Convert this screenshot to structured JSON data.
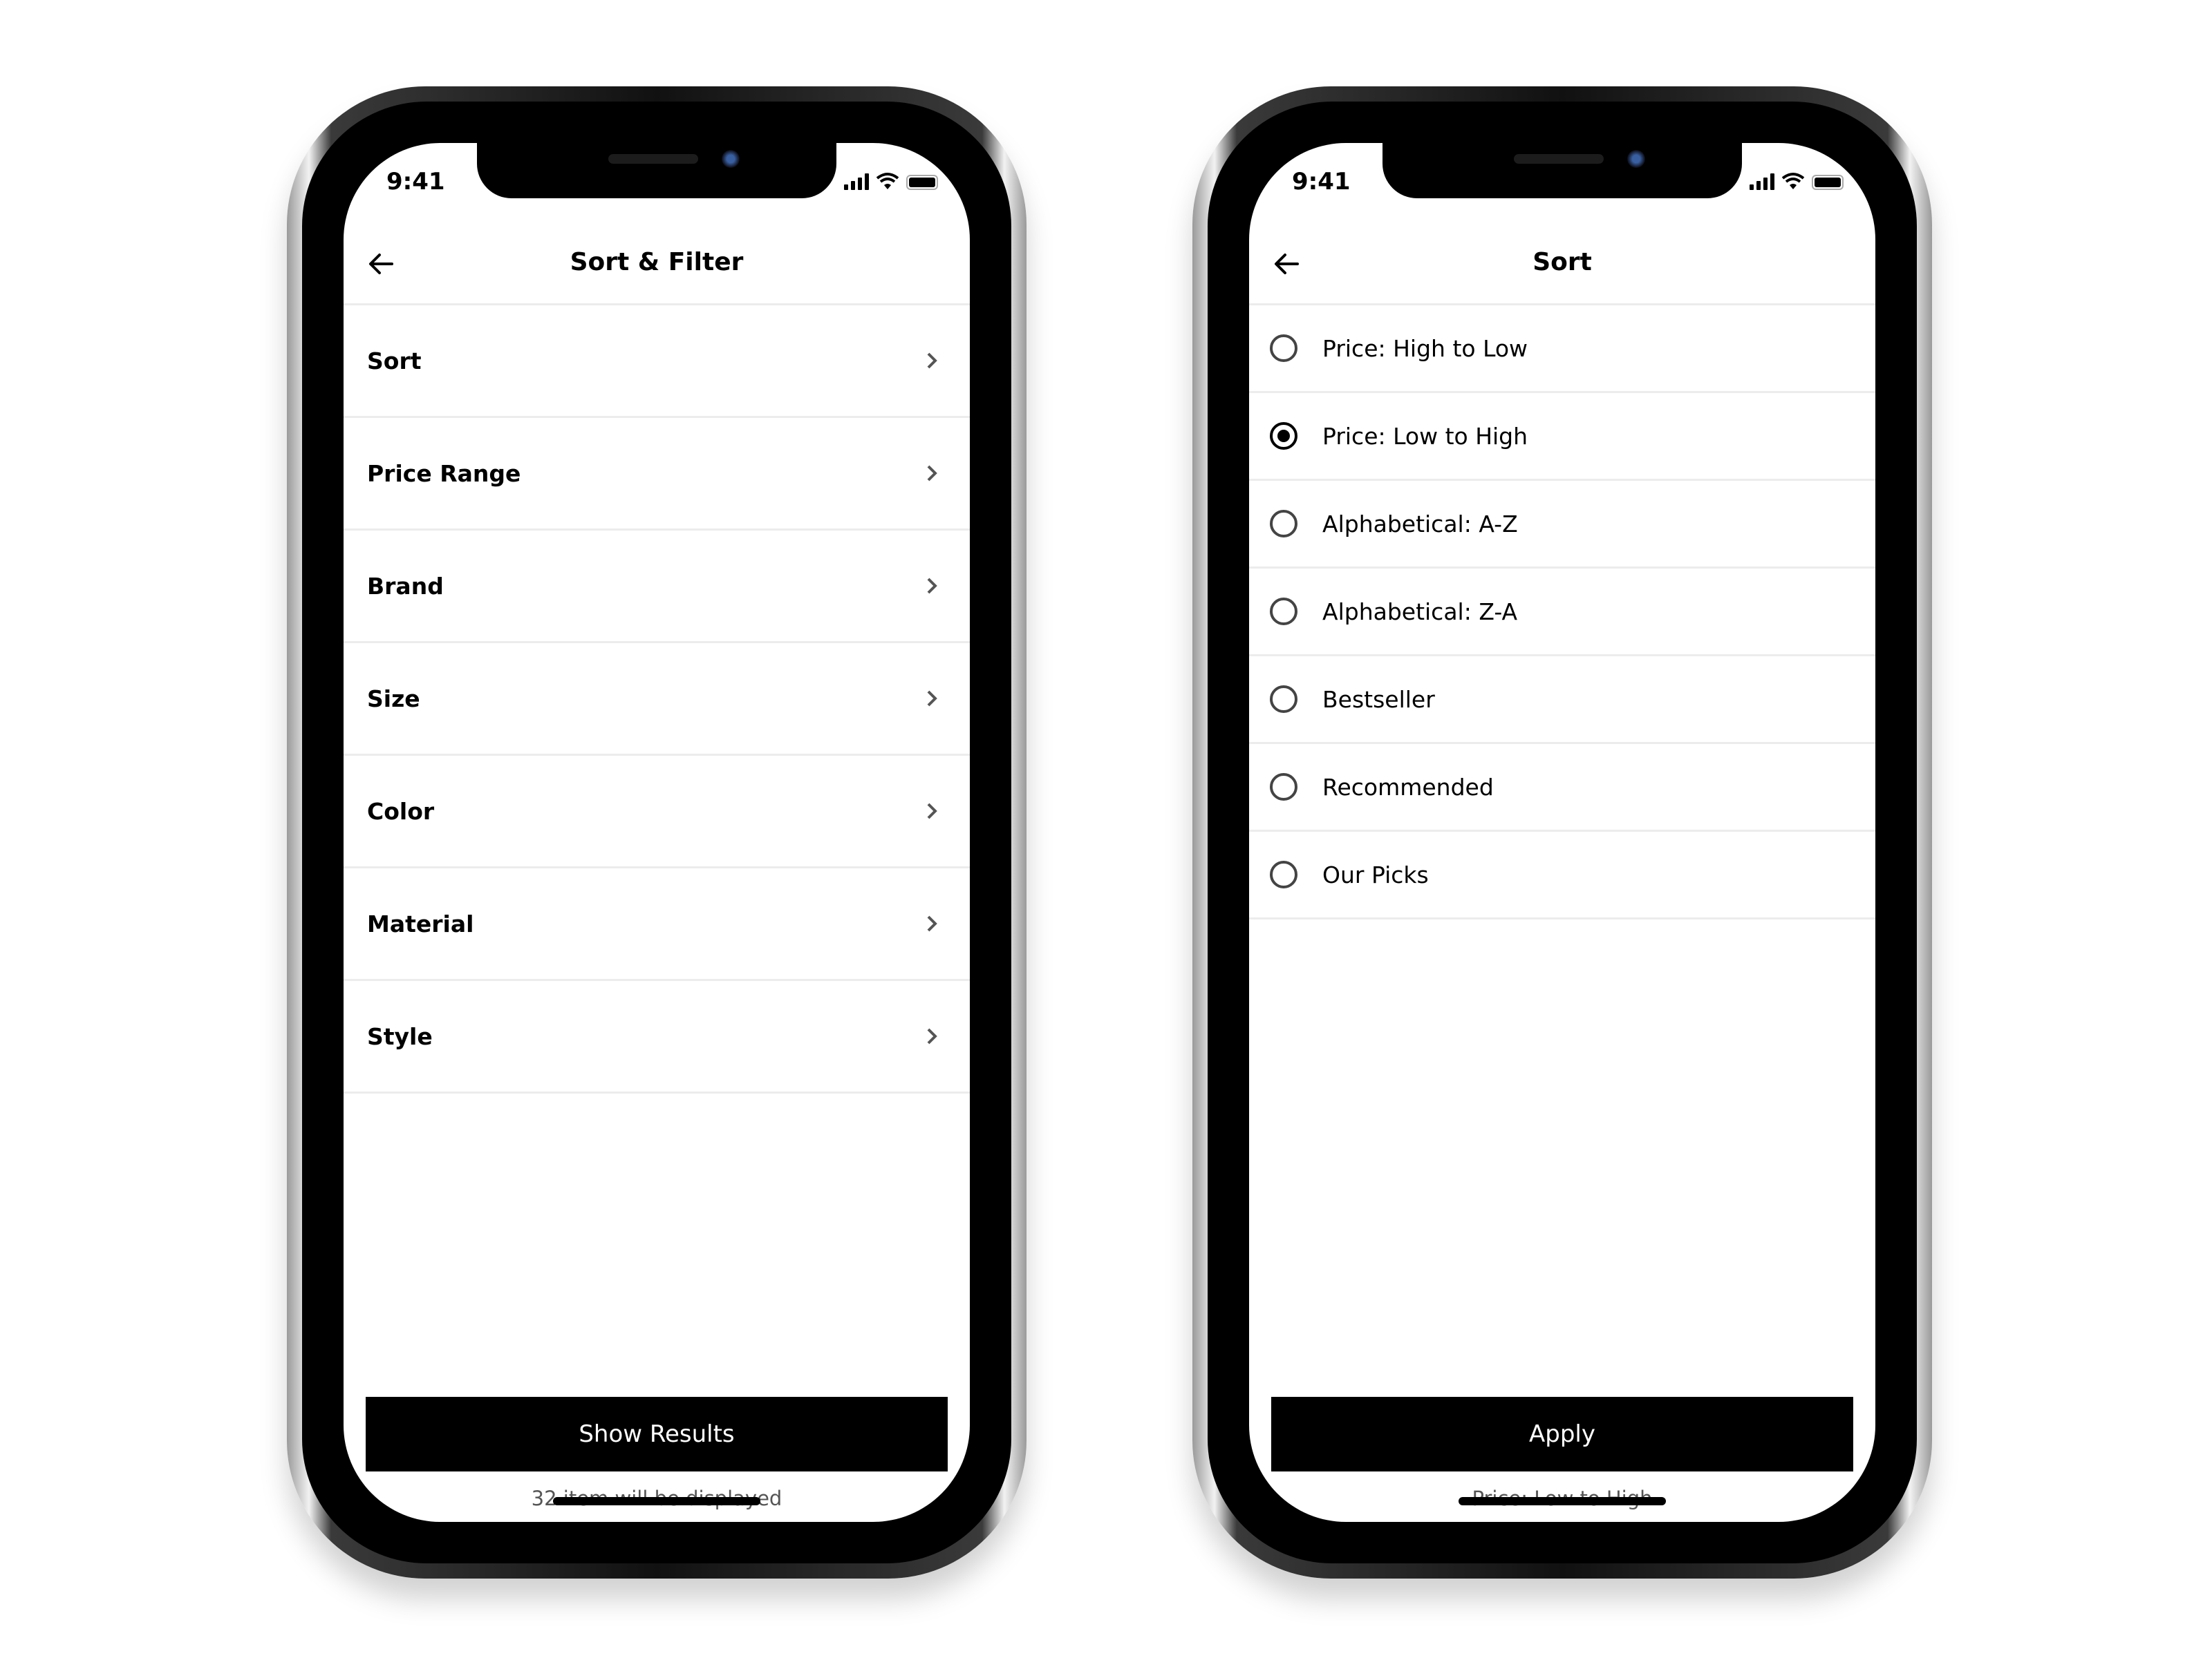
{
  "left_phone": {
    "status": {
      "time": "9:41"
    },
    "header": {
      "title": "Sort & Filter",
      "back_icon": "arrow-left-icon"
    },
    "filters": [
      {
        "label": "Sort"
      },
      {
        "label": "Price Range"
      },
      {
        "label": "Brand"
      },
      {
        "label": "Size"
      },
      {
        "label": "Color"
      },
      {
        "label": "Material"
      },
      {
        "label": "Style"
      }
    ],
    "cta_label": "Show Results",
    "note": "32 item will be displayed"
  },
  "right_phone": {
    "status": {
      "time": "9:41"
    },
    "header": {
      "title": "Sort",
      "back_icon": "arrow-left-icon"
    },
    "options": [
      {
        "label": "Price: High to Low",
        "selected": false
      },
      {
        "label": "Price: Low to High",
        "selected": true
      },
      {
        "label": "Alphabetical: A-Z",
        "selected": false
      },
      {
        "label": "Alphabetical: Z-A",
        "selected": false
      },
      {
        "label": "Bestseller",
        "selected": false
      },
      {
        "label": "Recommended",
        "selected": false
      },
      {
        "label": "Our Picks",
        "selected": false
      }
    ],
    "cta_label": "Apply",
    "note": "Price: Low to High"
  }
}
